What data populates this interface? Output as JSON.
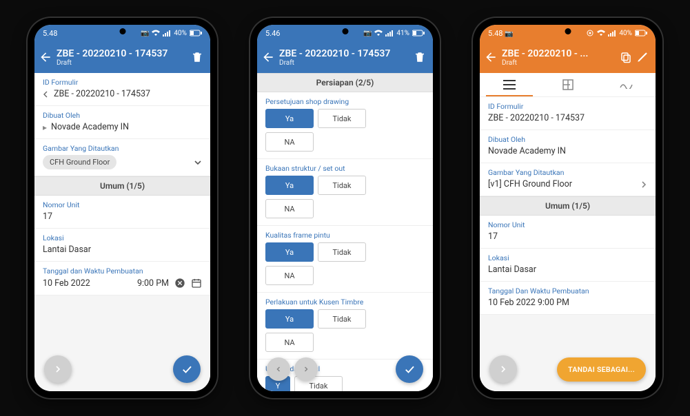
{
  "status": {
    "time1": "5.48",
    "time2": "5.46",
    "time3": "5.48",
    "battery1": "40%",
    "battery2": "41%",
    "battery3": "40%",
    "camera_icon": "📷"
  },
  "phone1": {
    "title": "ZBE - 20220210 - 174537",
    "subtitle": "Draft",
    "id_formulir_label": "ID Formulir",
    "id_formulir_value": "ZBE - 20220210 - 174537",
    "dibuat_label": "Dibuat Oleh",
    "dibuat_value": "Novade Academy IN",
    "gambar_label": "Gambar Yang Ditautkan",
    "gambar_chip": "CFH Ground Floor",
    "section_umum": "Umum (1/5)",
    "nomor_unit_label": "Nomor Unit",
    "nomor_unit_value": "17",
    "lokasi_label": "Lokasi",
    "lokasi_value": "Lantai Dasar",
    "tanggal_label": "Tanggal dan Waktu Pembuatan",
    "tanggal_date": "10 Feb 2022",
    "tanggal_time": "9:00 PM"
  },
  "phone2": {
    "title": "ZBE - 20220210 - 174537",
    "subtitle": "Draft",
    "section_persiapan": "Persiapan (2/5)",
    "q1_label": "Persetujuan shop drawing",
    "q2_label": "Bukaan struktur / set out",
    "q3_label": "Kualitas frame pintu",
    "q4_label": "Perlakuan untuk Kusen Timbre",
    "q5_label": "Ukuran dan profil",
    "ya": "Ya",
    "tidak": "Tidak",
    "na": "NA",
    "y_short": "Y"
  },
  "phone3": {
    "title": "ZBE - 20220210 - ...",
    "subtitle": "Draft",
    "id_formulir_label": "ID Formulir",
    "id_formulir_value": "ZBE - 20220210 - 174537",
    "dibuat_label": "Dibuat Oleh",
    "dibuat_value": "Novade Academy IN",
    "gambar_label": "Gambar Yang Ditautkan",
    "gambar_value": "[v1] CFH Ground Floor",
    "section_umum": "Umum (1/5)",
    "nomor_unit_label": "Nomor Unit",
    "nomor_unit_value": "17",
    "lokasi_label": "Lokasi",
    "lokasi_value": "Lantai Dasar",
    "tanggal_label": "Tanggal Dan Waktu Pembuatan",
    "tanggal_value": "10 Feb 2022 9:00 PM",
    "action_btn": "TANDAI SEBAGAI..."
  }
}
